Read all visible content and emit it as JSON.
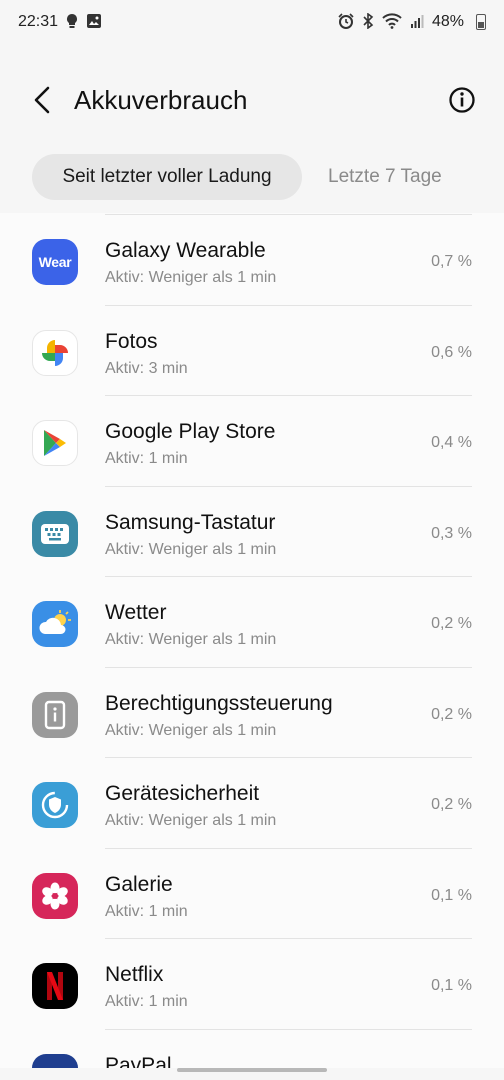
{
  "status_bar": {
    "time": "22:31",
    "battery": "48%"
  },
  "header": {
    "title": "Akkuverbrauch"
  },
  "tabs": [
    {
      "label": "Seit letzter voller Ladung",
      "active": true
    },
    {
      "label": "Letzte 7 Tage",
      "active": false
    }
  ],
  "apps": [
    {
      "name": "Galaxy Wearable",
      "active": "Aktiv: Weniger als 1 min",
      "percent": "0,7 %",
      "icon": "galaxy-wearable-icon",
      "icon_text": "Wear",
      "color": "#3b63e8"
    },
    {
      "name": "Fotos",
      "active": "Aktiv: 3 min",
      "percent": "0,6 %",
      "icon": "google-photos-icon",
      "color": "#ffffff"
    },
    {
      "name": "Google Play Store",
      "active": "Aktiv: 1 min",
      "percent": "0,4 %",
      "icon": "play-store-icon",
      "color": "#ffffff"
    },
    {
      "name": "Samsung-Tastatur",
      "active": "Aktiv: Weniger als 1 min",
      "percent": "0,3 %",
      "icon": "keyboard-icon",
      "color": "#3a8aa6"
    },
    {
      "name": "Wetter",
      "active": "Aktiv: Weniger als 1 min",
      "percent": "0,2 %",
      "icon": "weather-icon",
      "color": "#3a8fe6"
    },
    {
      "name": "Berechtigungssteuerung",
      "active": "Aktiv: Weniger als 1 min",
      "percent": "0,2 %",
      "icon": "permission-controller-icon",
      "color": "#9a9a9a"
    },
    {
      "name": "Gerätesicherheit",
      "active": "Aktiv: Weniger als 1 min",
      "percent": "0,2 %",
      "icon": "device-security-icon",
      "color": "#3a9ed6"
    },
    {
      "name": "Galerie",
      "active": "Aktiv: 1 min",
      "percent": "0,1 %",
      "icon": "gallery-icon",
      "color": "#d6265a"
    },
    {
      "name": "Netflix",
      "active": "Aktiv: 1 min",
      "percent": "0,1 %",
      "icon": "netflix-icon",
      "color": "#000000"
    },
    {
      "name": "PayPal",
      "active": "",
      "percent": "",
      "icon": "paypal-icon",
      "color": "#1f3e8f"
    }
  ]
}
